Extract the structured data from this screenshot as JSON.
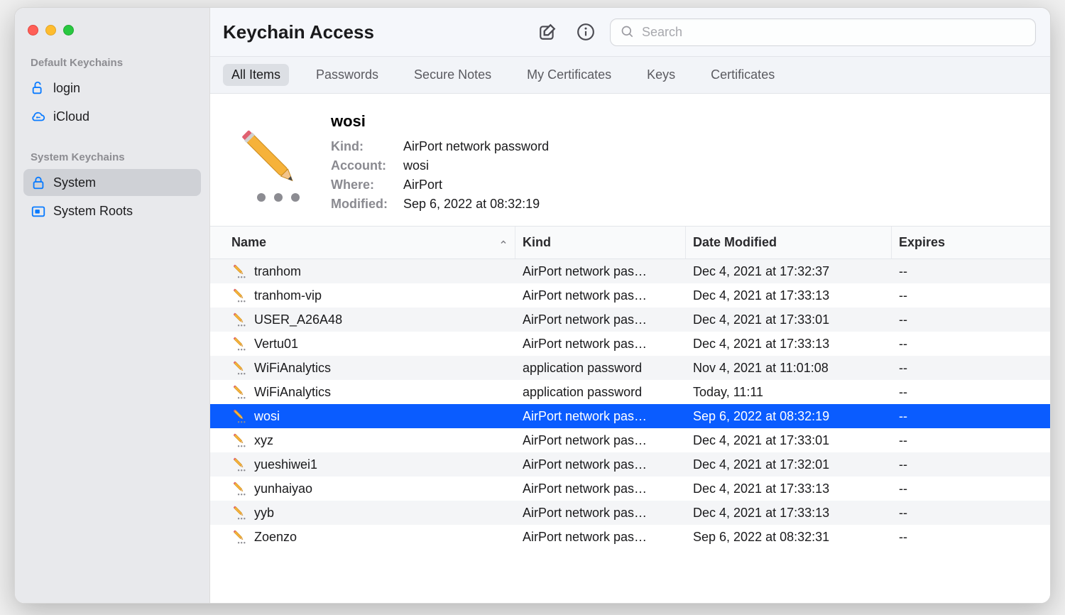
{
  "app_title": "Keychain Access",
  "search": {
    "placeholder": "Search"
  },
  "sidebar": {
    "default_label": "Default Keychains",
    "system_label": "System Keychains",
    "default_items": [
      {
        "label": "login"
      },
      {
        "label": "iCloud"
      }
    ],
    "system_items": [
      {
        "label": "System"
      },
      {
        "label": "System Roots"
      }
    ]
  },
  "tabs": [
    {
      "label": "All Items",
      "active": true
    },
    {
      "label": "Passwords"
    },
    {
      "label": "Secure Notes"
    },
    {
      "label": "My Certificates"
    },
    {
      "label": "Keys"
    },
    {
      "label": "Certificates"
    }
  ],
  "detail": {
    "title": "wosi",
    "kind_label": "Kind:",
    "kind_value": "AirPort network password",
    "account_label": "Account:",
    "account_value": "wosi",
    "where_label": "Where:",
    "where_value": "AirPort",
    "modified_label": "Modified:",
    "modified_value": "Sep 6, 2022 at 08:32:19"
  },
  "columns": {
    "name": "Name",
    "kind": "Kind",
    "date": "Date Modified",
    "expires": "Expires"
  },
  "rows": [
    {
      "name": "tranhom",
      "kind": "AirPort network pas…",
      "date": "Dec 4, 2021 at 17:32:37",
      "expires": "--"
    },
    {
      "name": "tranhom-vip",
      "kind": "AirPort network pas…",
      "date": "Dec 4, 2021 at 17:33:13",
      "expires": "--"
    },
    {
      "name": "USER_A26A48",
      "kind": "AirPort network pas…",
      "date": "Dec 4, 2021 at 17:33:01",
      "expires": "--"
    },
    {
      "name": "Vertu01",
      "kind": "AirPort network pas…",
      "date": "Dec 4, 2021 at 17:33:13",
      "expires": "--"
    },
    {
      "name": "WiFiAnalytics",
      "kind": "application password",
      "date": "Nov 4, 2021 at 11:01:08",
      "expires": "--"
    },
    {
      "name": "WiFiAnalytics",
      "kind": "application password",
      "date": "Today, 11:11",
      "expires": "--"
    },
    {
      "name": "wosi",
      "kind": "AirPort network pas…",
      "date": "Sep 6, 2022 at 08:32:19",
      "expires": "--",
      "selected": true
    },
    {
      "name": "xyz",
      "kind": "AirPort network pas…",
      "date": "Dec 4, 2021 at 17:33:01",
      "expires": "--"
    },
    {
      "name": "yueshiwei1",
      "kind": "AirPort network pas…",
      "date": "Dec 4, 2021 at 17:32:01",
      "expires": "--"
    },
    {
      "name": "yunhaiyao",
      "kind": "AirPort network pas…",
      "date": "Dec 4, 2021 at 17:33:13",
      "expires": "--"
    },
    {
      "name": "yyb",
      "kind": "AirPort network pas…",
      "date": "Dec 4, 2021 at 17:33:13",
      "expires": "--"
    },
    {
      "name": "Zoenzo",
      "kind": "AirPort network pas…",
      "date": "Sep 6, 2022 at 08:32:31",
      "expires": "--"
    }
  ]
}
